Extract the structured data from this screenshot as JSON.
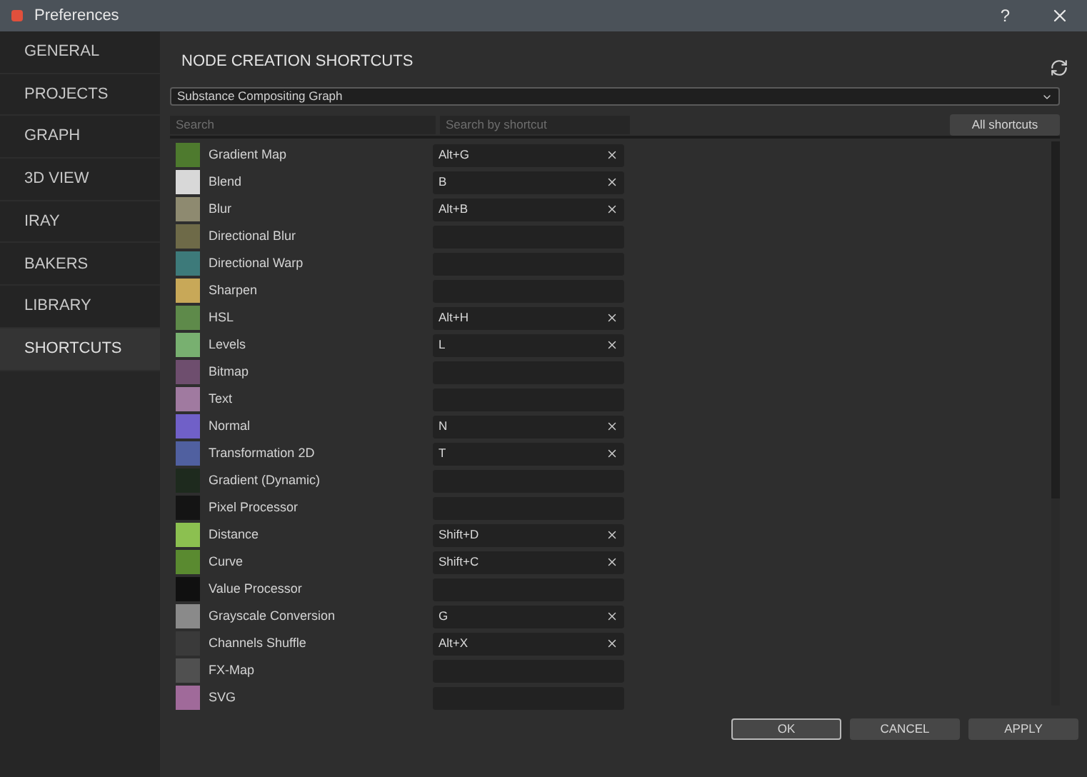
{
  "window": {
    "title": "Preferences",
    "help": "?"
  },
  "sidebar": {
    "items": [
      {
        "label": "GENERAL",
        "selected": false
      },
      {
        "label": "PROJECTS",
        "selected": false
      },
      {
        "label": "GRAPH",
        "selected": false
      },
      {
        "label": "3D VIEW",
        "selected": false
      },
      {
        "label": "IRAY",
        "selected": false
      },
      {
        "label": "BAKERS",
        "selected": false
      },
      {
        "label": "LIBRARY",
        "selected": false
      },
      {
        "label": "SHORTCUTS",
        "selected": true
      }
    ]
  },
  "panel": {
    "title": "NODE CREATION SHORTCUTS",
    "graph_type": "Substance Compositing Graph",
    "search": {
      "placeholder": "Search"
    },
    "shortcut_search": {
      "placeholder": "Search by shortcut"
    },
    "all_shortcuts_button": "All shortcuts"
  },
  "nodes": [
    {
      "name": "Gradient Map",
      "shortcut": "Alt+G",
      "color": "#4e7a2e"
    },
    {
      "name": "Blend",
      "shortcut": "B",
      "color": "#d8d8d8"
    },
    {
      "name": "Blur",
      "shortcut": "Alt+B",
      "color": "#8e8a70"
    },
    {
      "name": "Directional Blur",
      "color": "#6e6a48"
    },
    {
      "name": "Directional Warp",
      "color": "#3d7a7a"
    },
    {
      "name": "Sharpen",
      "color": "#c8a858"
    },
    {
      "name": "HSL",
      "shortcut": "Alt+H",
      "color": "#5e8a4a"
    },
    {
      "name": "Levels",
      "shortcut": "L",
      "color": "#78b070"
    },
    {
      "name": "Bitmap",
      "color": "#6e4e6e"
    },
    {
      "name": "Text",
      "color": "#a07aa0"
    },
    {
      "name": "Normal",
      "shortcut": "N",
      "color": "#7060c8"
    },
    {
      "name": "Transformation 2D",
      "shortcut": "T",
      "color": "#5060a0"
    },
    {
      "name": "Gradient (Dynamic)",
      "color": "#1e2a1e"
    },
    {
      "name": "Pixel Processor",
      "color": "#141414"
    },
    {
      "name": "Distance",
      "shortcut": "Shift+D",
      "color": "#8cc050"
    },
    {
      "name": "Curve",
      "shortcut": "Shift+C",
      "color": "#5a8a30"
    },
    {
      "name": "Value Processor",
      "color": "#101010"
    },
    {
      "name": "Grayscale Conversion",
      "shortcut": "G",
      "color": "#8a8a8a"
    },
    {
      "name": "Channels Shuffle",
      "shortcut": "Alt+X",
      "color": "#3a3a3a"
    },
    {
      "name": "FX-Map",
      "color": "#505050"
    },
    {
      "name": "SVG",
      "color": "#a06a9a"
    }
  ],
  "footer": {
    "buttons": [
      {
        "label": "OK",
        "selected": true
      },
      {
        "label": "CANCEL",
        "selected": false
      },
      {
        "label": "APPLY",
        "selected": false
      }
    ]
  }
}
